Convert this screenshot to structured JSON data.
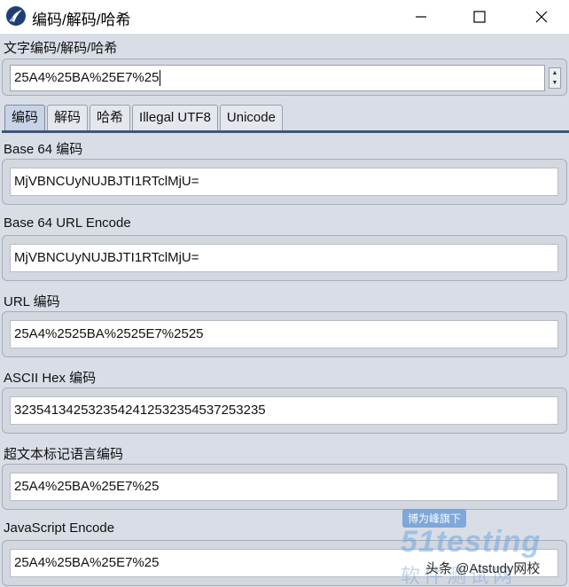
{
  "window": {
    "title": "编码/解码/哈希",
    "controls": [
      "minimize",
      "maximize",
      "close"
    ]
  },
  "input_section": {
    "label": "文字编码/解码/哈希",
    "value": "25A4%25BA%25E7%25"
  },
  "tabs": [
    {
      "label": "编码",
      "active": true
    },
    {
      "label": "解码",
      "active": false
    },
    {
      "label": "哈希",
      "active": false
    },
    {
      "label": "Illegal UTF8",
      "active": false
    },
    {
      "label": "Unicode",
      "active": false
    }
  ],
  "outputs": [
    {
      "label": "Base 64 编码",
      "value": "MjVBNCUyNUJBJTI1RTclMjU="
    },
    {
      "label": "Base 64 URL Encode",
      "value": "MjVBNCUyNUJBJTI1RTclMjU="
    },
    {
      "label": "URL 编码",
      "value": "25A4%2525BA%2525E7%2525"
    },
    {
      "label": "ASCII Hex 编码",
      "value": "323541342532354241253235453725323 5"
    },
    {
      "label": "超文本标记语言编码",
      "value": "25A4%25BA%25E7%25"
    },
    {
      "label": "JavaScript Encode",
      "value": "25A4%25BA%25E7%25"
    }
  ],
  "watermark": {
    "banner": "博为峰旗下",
    "logo": "51testing",
    "sub": "软件测试网",
    "credit": "头条 @Atstudy网校"
  },
  "colors": {
    "window_bg": "#d9dde6",
    "tab_underline": "#3f5577",
    "active_tab": "#c7d3e6"
  }
}
